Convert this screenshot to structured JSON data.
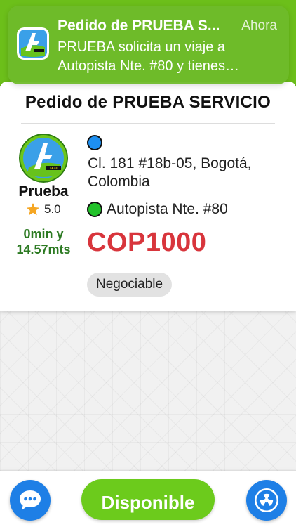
{
  "notification": {
    "title": "Pedido de PRUEBA S...",
    "time": "Ahora",
    "body": "PRUEBA solicita un viaje a Autopista Nte. #80 y tienes…",
    "icon": "taxi-app-logo"
  },
  "card": {
    "title": "Pedido de PRUEBA SERVICIO",
    "user_name": "Prueba",
    "rating": "5.0",
    "eta": "0min y\n14.57mts",
    "origin_address": "Cl. 181 #18b-05, Bogotá, Colombia",
    "destination_address": "Autopista Nte. #80",
    "price": "COP1000",
    "chip_label": "Negociable",
    "logo_text": "TAXI"
  },
  "bottom": {
    "available_label": "Disponible",
    "chat_icon": "chat-bubble-icon",
    "radio_icon": "radiation-icon"
  },
  "colors": {
    "brand_green": "#6cbf1a",
    "price_red": "#d8353c",
    "eta_green": "#2c7a22",
    "button_blue": "#1e7fe6",
    "origin_pin": "#1d8ff0",
    "dest_pin": "#22c22a"
  }
}
